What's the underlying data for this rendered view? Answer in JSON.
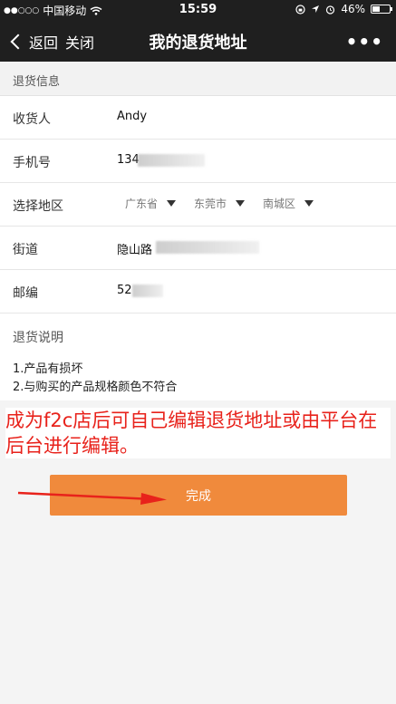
{
  "status_bar": {
    "signal_dots": "●●○○○",
    "carrier": "中国移动",
    "time": "15:59",
    "battery_percent": "46%",
    "battery_level": 0.46
  },
  "nav": {
    "back_label": "返回",
    "close_label": "关闭",
    "title": "我的退货地址",
    "more_label": "•••"
  },
  "section_title": "退货信息",
  "form": {
    "receiver_label": "收货人",
    "receiver_value": "Andy",
    "phone_label": "手机号",
    "phone_value": "134",
    "region_label": "选择地区",
    "province": "广东省",
    "city": "东莞市",
    "district": "南城区",
    "street_label": "街道",
    "street_value": "隐山路",
    "postcode_label": "邮编",
    "postcode_value": "52"
  },
  "notes": {
    "title": "退货说明",
    "line1": "1.产品有损坏",
    "line2": "2.与购买的产品规格颜色不符合"
  },
  "annotation_text": "成为f2c店后可自己编辑退货地址或由平台在后台进行编辑。",
  "done_label": "完成",
  "colors": {
    "accent": "#f08a3c",
    "annotation": "#e8221b",
    "nav_bg": "#1f1f1f"
  }
}
